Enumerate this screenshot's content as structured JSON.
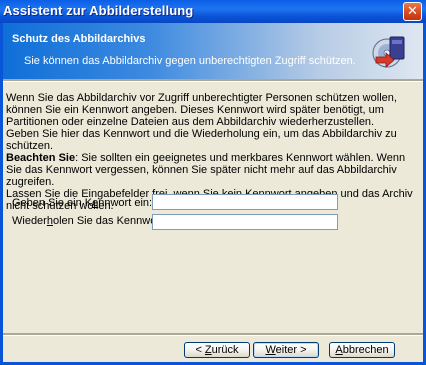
{
  "window": {
    "title": "Assistent zur Abbilderstellung",
    "close_symbol": "✕"
  },
  "header": {
    "title": "Schutz des Abbildarchivs",
    "subtitle": "Sie können das Abbildarchiv gegen unberechtigten Zugriff schützen.",
    "icon": "backup-disc-arrow-icon"
  },
  "description": {
    "line1": "Wenn Sie das Abbildarchiv vor Zugriff unberechtigter Personen schützen wollen, können Sie ein Kennwort angeben. Dieses Kennwort wird später benötigt, um Partitionen oder einzelne Dateien aus dem Abbildarchiv wiederherzustellen.",
    "line2": "Geben Sie hier das Kennwort und die Wiederholung ein, um das Abbildarchiv zu schützen.",
    "note_bold": "Beachten Sie",
    "note_text": ": Sie sollten ein geeignetes und merkbares Kennwort wählen. Wenn Sie das Kennwort vergessen, können Sie später nicht mehr auf das Abbildarchiv zugreifen.",
    "line4": "Lassen Sie die Eingabefelder frei, wenn Sie kein Kennwort angeben und das Archiv nicht schützen wollen."
  },
  "fields": {
    "password_label_a": "Geben Sie ein K",
    "password_label_u": "e",
    "password_label_b": "nnwort ein:",
    "password_value": "",
    "repeat_label_a": "Wieder",
    "repeat_label_u": "h",
    "repeat_label_b": "olen Sie das Kennwort:",
    "repeat_value": ""
  },
  "buttons": {
    "back_prefix": "< ",
    "back_u": "Z",
    "back_rest": "urück",
    "next_u": "W",
    "next_rest": "eiter >",
    "cancel_u": "A",
    "cancel_rest": "bbrechen"
  },
  "colors": {
    "title_bar": "#0a54d8",
    "close_button": "#d6471f",
    "dialog_bg": "#ece9d8"
  }
}
